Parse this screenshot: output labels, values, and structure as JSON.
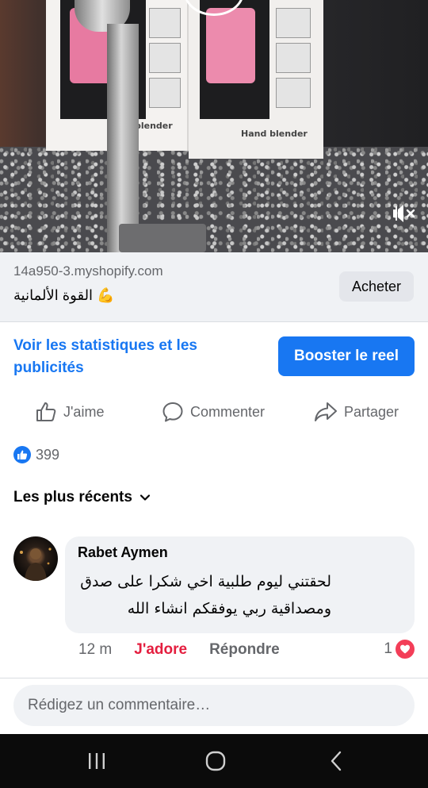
{
  "video": {
    "box_left_label": "blender",
    "box_right_label": "Hand blender",
    "mute_icon": "speaker-muted-icon"
  },
  "link": {
    "domain": "14a950-3.myshopify.com",
    "tagline": "القوة الألمانية 💪",
    "cta": "Acheter"
  },
  "promo": {
    "stats_link": "Voir les statistiques et les publicités",
    "boost_label": "Booster le reel"
  },
  "actions": {
    "like": "J'aime",
    "comment": "Commenter",
    "share": "Partager"
  },
  "reactions": {
    "count": "399"
  },
  "sort": {
    "label": "Les plus récents"
  },
  "comment": {
    "author": "Rabet Aymen",
    "text": "لحقتني ليوم طلبية اخي شكرا على صدق ومصداقية ربي يوفقكم انشاء الله",
    "time": "12 m",
    "reaction_label": "J'adore",
    "reply_label": "Répondre",
    "heart_count": "1"
  },
  "composer": {
    "placeholder": "Rédigez un commentaire…"
  },
  "colors": {
    "accent": "#1877f2",
    "love": "#f33e58",
    "jadore": "#e41e3f",
    "muted_text": "#65676b",
    "surface": "#f0f2f5"
  }
}
